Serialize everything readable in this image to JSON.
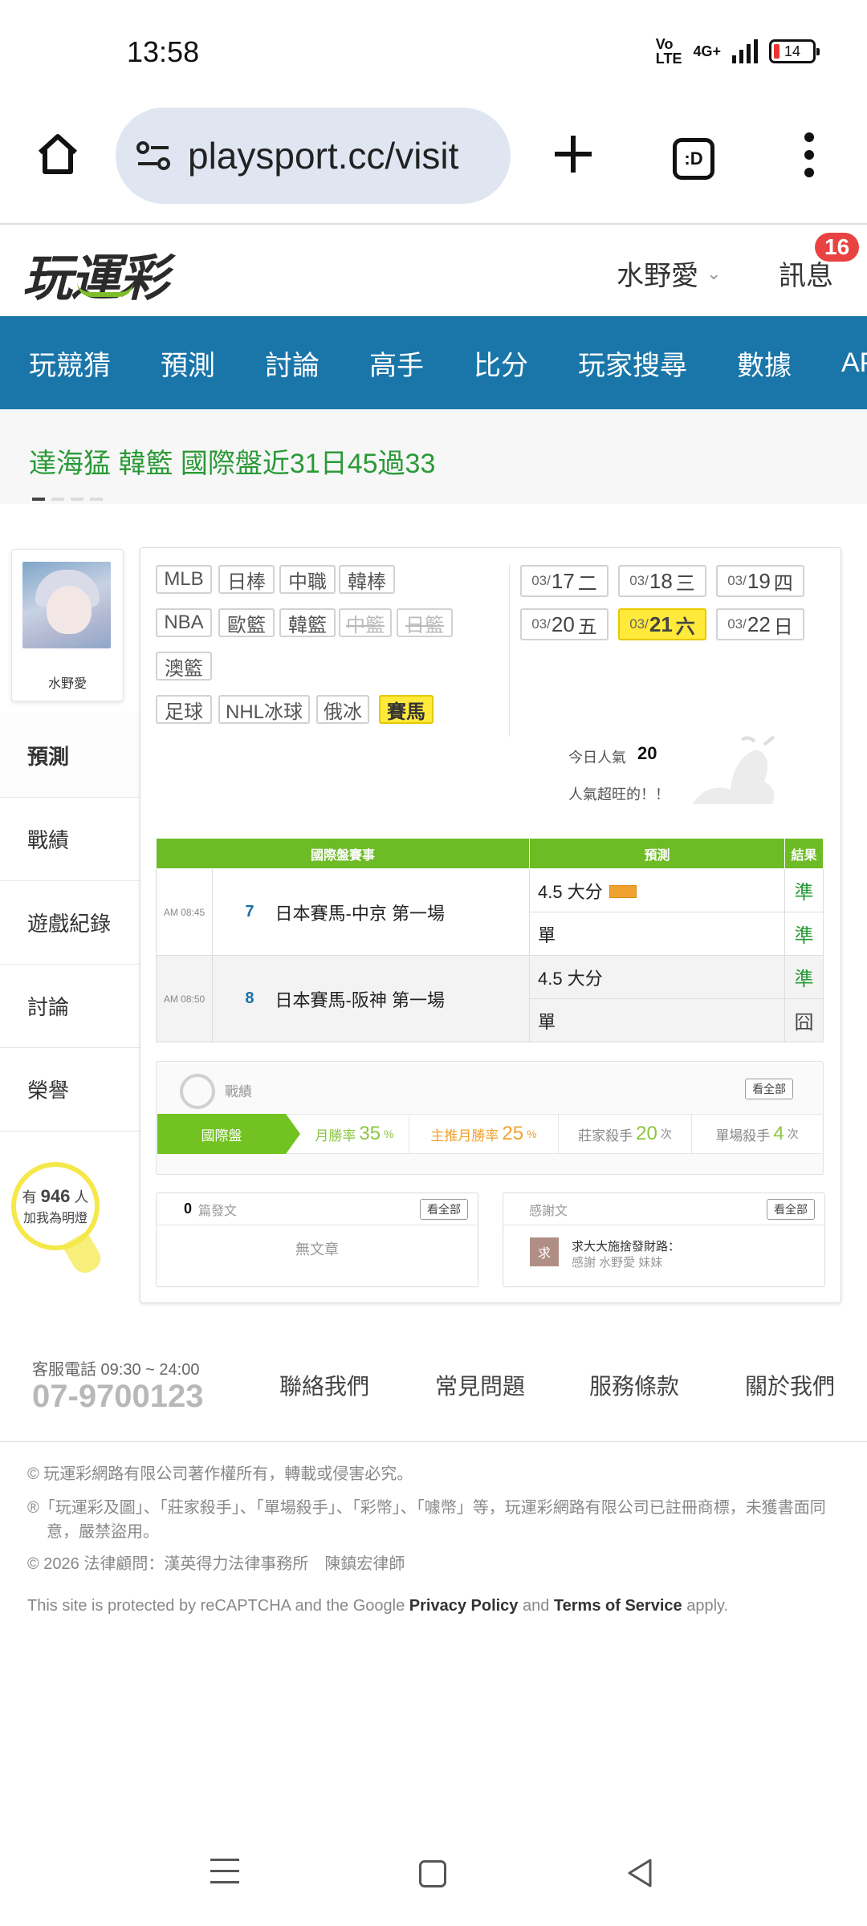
{
  "status_bar": {
    "time": "13:58",
    "network": "4G+",
    "battery": "14"
  },
  "browser": {
    "url": "playsport.cc/visit",
    "tab_icon_text": ":D"
  },
  "site_header": {
    "logo": "玩運彩",
    "username": "水野愛",
    "messages_label": "訊息",
    "messages_count": "16"
  },
  "nav": {
    "items": [
      "玩競猜",
      "預測",
      "討論",
      "高手",
      "比分",
      "玩家搜尋",
      "數據",
      "APP"
    ]
  },
  "ticker": {
    "text": "達海猛 韓籃 國際盤近31日45過33"
  },
  "profile": {
    "name": "水野愛",
    "menu": [
      "預測",
      "戰績",
      "遊戲紀錄",
      "討論",
      "榮譽"
    ],
    "bulb": {
      "prefix": "有",
      "count": "946",
      "suffix": "人",
      "line2": "加我為明燈"
    }
  },
  "sports": {
    "row1": [
      "MLB",
      "日棒",
      "中職",
      "韓棒"
    ],
    "row2": [
      "NBA",
      "歐籃",
      "韓籃",
      "中籃",
      "日籃"
    ],
    "row3": [
      "澳籃"
    ],
    "row4": [
      "足球",
      "NHL冰球",
      "俄冰",
      "賽馬"
    ]
  },
  "dates": [
    {
      "md": "03/",
      "d": "17",
      "wd": "二"
    },
    {
      "md": "03/",
      "d": "18",
      "wd": "三"
    },
    {
      "md": "03/",
      "d": "19",
      "wd": "四"
    },
    {
      "md": "03/",
      "d": "20",
      "wd": "五"
    },
    {
      "md": "03/",
      "d": "21",
      "wd": "六"
    },
    {
      "md": "03/",
      "d": "22",
      "wd": "日"
    }
  ],
  "popularity": {
    "label": "今日人氣",
    "value": "20",
    "text": "人氣超旺的！！"
  },
  "table": {
    "headers": [
      "國際盤賽事",
      "預測",
      "結果"
    ],
    "rows": [
      {
        "time": "AM 08:45",
        "num": "7",
        "race": "日本賽馬-中京 第一場",
        "pred1": "4.5 大分",
        "res1": "準",
        "pred2": "單",
        "res2": "準"
      },
      {
        "time": "AM 08:50",
        "num": "8",
        "race": "日本賽馬-阪神 第一場",
        "pred1": "4.5 大分",
        "res1": "準",
        "pred2": "單",
        "res2": "囧"
      }
    ]
  },
  "record": {
    "title": "戰績",
    "view_all": "看全部",
    "tab": "國際盤",
    "stats": [
      {
        "label": "月勝率",
        "value": "35",
        "unit": "%",
        "color": "#8cc63f"
      },
      {
        "label": "主推月勝率",
        "value": "25",
        "unit": "%",
        "color": "#f0a22e"
      },
      {
        "label": "莊家殺手",
        "value": "20",
        "unit": "次",
        "color": "#8cc63f"
      },
      {
        "label": "單場殺手",
        "value": "4",
        "unit": "次",
        "color": "#8cc63f"
      }
    ]
  },
  "articles": {
    "count": "0",
    "label": "篇發文",
    "view_all": "看全部",
    "empty": "無文章"
  },
  "thanks": {
    "title": "感謝文",
    "view_all": "看全部",
    "avatar": "求",
    "line1": "求大大施捨發財路：",
    "line2": "感謝 水野愛 妹妹"
  },
  "footer": {
    "service_label": "客服電話 09:30 ~ 24:00",
    "phone": "07-9700123",
    "links": [
      "聯絡我們",
      "常見問題",
      "服務條款",
      "關於我們"
    ],
    "copyright": "© 玩運彩網路有限公司著作權所有，轉載或侵害必究。",
    "trademark": "®「玩運彩及圖」、「莊家殺手」、「單場殺手」、「彩幣」、「噱幣」等，玩運彩網路有限公司已註冊商標，未獲書面同意，嚴禁盜用。",
    "legal": "© 2026 法律顧問：漢英得力法律事務所　陳鎮宏律師",
    "recaptcha_pre": "This site is protected by reCAPTCHA and the Google ",
    "privacy": "Privacy Policy",
    "and": " and ",
    "terms": "Terms of Service",
    "apply": " apply."
  },
  "colors": {
    "nav_bg": "#1a76a9",
    "table_head": "#6dbb25",
    "accent_yellow": "#ffe93a",
    "success": "#2a9a36"
  }
}
